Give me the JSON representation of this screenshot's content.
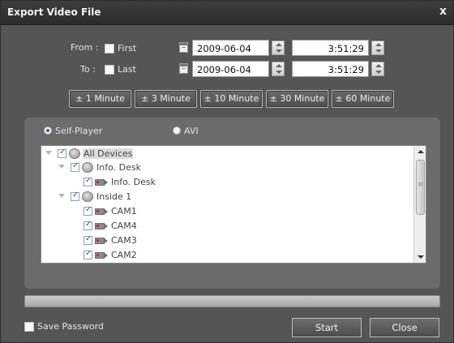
{
  "window": {
    "title": "Export Video File",
    "close_glyph": "x"
  },
  "range": {
    "from_label": "From :",
    "first_label": "First",
    "first_checked": false,
    "from_date": "2009-06-04",
    "from_time": "3:51:29",
    "to_label": "To :",
    "last_label": "Last",
    "last_checked": false,
    "to_date": "2009-06-04",
    "to_time": "3:51:29"
  },
  "quick_buttons": [
    "± 1 Minute",
    "± 3 Minute",
    "± 10 Minute",
    "± 30 Minute",
    "± 60 Minute"
  ],
  "format": {
    "options": [
      "Self-Player",
      "AVI"
    ],
    "selected": "Self-Player"
  },
  "tree": {
    "nodes": [
      {
        "label": "All Devices",
        "type": "group",
        "expanded": true,
        "checked": true
      },
      {
        "label": "Info. Desk",
        "type": "group",
        "expanded": true,
        "checked": true
      },
      {
        "label": "Info. Desk",
        "type": "camera",
        "checked": true
      },
      {
        "label": "Inside 1",
        "type": "group",
        "expanded": true,
        "checked": true
      },
      {
        "label": "CAM1",
        "type": "camera",
        "checked": true
      },
      {
        "label": "CAM4",
        "type": "camera",
        "checked": true
      },
      {
        "label": "CAM3",
        "type": "camera",
        "checked": true
      },
      {
        "label": "CAM2",
        "type": "camera",
        "checked": true
      }
    ]
  },
  "progress": {
    "value": 0
  },
  "footer": {
    "save_password_label": "Save Password",
    "save_password_checked": false,
    "start_label": "Start",
    "close_label": "Close"
  },
  "colors": {
    "accent": "#2a5fa6",
    "background": "#555555",
    "panel": "#6b6b6b"
  },
  "icons": {
    "calendar": "calendar-icon",
    "spinner": "spinner-icon",
    "group": "device-group-icon",
    "camera": "camera-icon",
    "expander": "triangle-down-icon"
  }
}
